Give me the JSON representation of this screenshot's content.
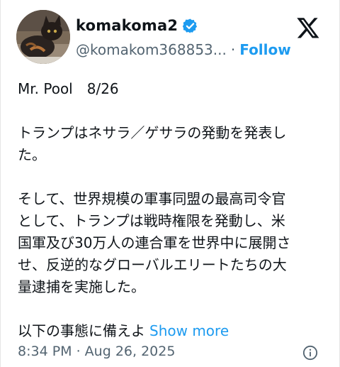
{
  "author": {
    "display_name": "komakoma2",
    "handle": "@komakom368853...",
    "separator": "·",
    "follow_label": "Follow",
    "avatar_icon": "cat-avatar-icon",
    "verified_icon": "verified-badge-icon",
    "verified_color": "#1d9bf0"
  },
  "brand": {
    "logo_icon": "x-logo-icon"
  },
  "post": {
    "paragraphs": [
      {
        "lines": [
          "Mr. Pool　8/26"
        ]
      },
      {
        "lines": [
          "トランプはネサラ／ゲサラの発動を発表し",
          "た。"
        ]
      },
      {
        "lines": [
          "そして、世界規模の軍事同盟の最高司令官",
          "として、トランプは戦時権限を発動し、米",
          "国軍及び30万人の連合軍を世界中に展開さ",
          "せ、反逆的なグローバルエリートたちの大",
          "量逮捕を実施した。"
        ]
      }
    ],
    "last_line": "以下の事態に備えよ",
    "show_more_label": "Show more"
  },
  "footer": {
    "timestamp": "8:34 PM · Aug 26, 2025",
    "info_icon": "info-icon"
  },
  "colors": {
    "accent": "#1d9bf0",
    "text": "#0f1419",
    "secondary": "#536471"
  }
}
